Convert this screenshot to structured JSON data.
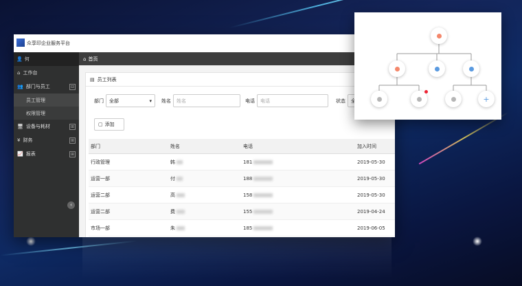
{
  "app": {
    "title": "众享印企业服务平台"
  },
  "user": {
    "name": "何"
  },
  "sidebar": {
    "items": [
      {
        "label": "工作台",
        "icon": "home-icon"
      },
      {
        "label": "部门与员工",
        "icon": "people-icon",
        "expanded": true,
        "toggle": "⊟"
      },
      {
        "label": "设备与耗材",
        "icon": "device-icon",
        "toggle": "⊞"
      },
      {
        "label": "财务",
        "icon": "yen-icon",
        "toggle": "⊞"
      },
      {
        "label": "报表",
        "icon": "chart-icon",
        "toggle": "⊞"
      }
    ],
    "subitems": [
      "员工管理",
      "权限管理"
    ]
  },
  "breadcrumb": {
    "home": "首页"
  },
  "panel": {
    "title": "员工列表"
  },
  "filters": {
    "dept_label": "部门",
    "dept_value": "全部",
    "name_label": "姓名",
    "name_placeholder": "姓名",
    "phone_label": "电话",
    "phone_placeholder": "电话",
    "status_label": "状态",
    "status_value": "全"
  },
  "add_label": "添加",
  "table": {
    "headers": [
      "部门",
      "姓名",
      "电话",
      "加入时间"
    ],
    "rows": [
      {
        "dept": "行政管理",
        "name": "韩",
        "phone": "181",
        "date": "2019-05-30"
      },
      {
        "dept": "运营一部",
        "name": "付",
        "phone": "188",
        "date": "2019-05-30"
      },
      {
        "dept": "运营二部",
        "name": "高",
        "phone": "158",
        "date": "2019-05-30"
      },
      {
        "dept": "运营二部",
        "name": "费",
        "phone": "155",
        "date": "2019-04-24"
      },
      {
        "dept": "市场一部",
        "name": "朱",
        "phone": "185",
        "date": "2019-06-05"
      }
    ]
  },
  "colors": {
    "accent": "#3a6fd8",
    "sidebar": "#2f3030",
    "female": "#f4876b",
    "male": "#5a9ae0",
    "vacant": "#b5b5b5"
  },
  "org_chart": {
    "add_symbol": "+"
  }
}
